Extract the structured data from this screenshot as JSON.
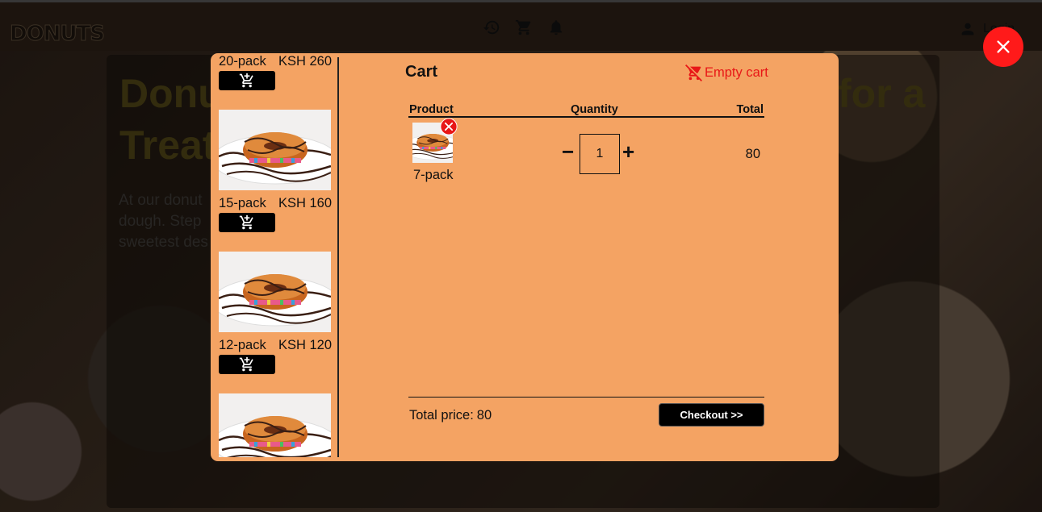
{
  "background": {
    "logo_text": "DONUTS",
    "login_label": "Login",
    "hero_title_line1": "Donu",
    "hero_title_line2": "Treat",
    "hero_title_right": "for a",
    "hero_text_line1": "At our donut",
    "hero_text_line2": "dough. Step",
    "hero_text_line3": "sweetest des"
  },
  "products": [
    {
      "name": "20-pack",
      "price": "KSH 260"
    },
    {
      "name": "15-pack",
      "price": "KSH 160"
    },
    {
      "name": "12-pack",
      "price": "KSH 120"
    }
  ],
  "cart": {
    "title": "Cart",
    "empty_label": "Empty cart",
    "columns": {
      "product": "Product",
      "quantity": "Quantity",
      "total": "Total"
    },
    "items": [
      {
        "name": "7-pack",
        "quantity": "1",
        "total": "80"
      }
    ],
    "total_label": "Total price:",
    "total_value": "80",
    "checkout_label": "Checkout >>"
  },
  "colors": {
    "modal": "#f4a363",
    "accent_red": "#e81717",
    "close_red": "#ff1a1a"
  }
}
